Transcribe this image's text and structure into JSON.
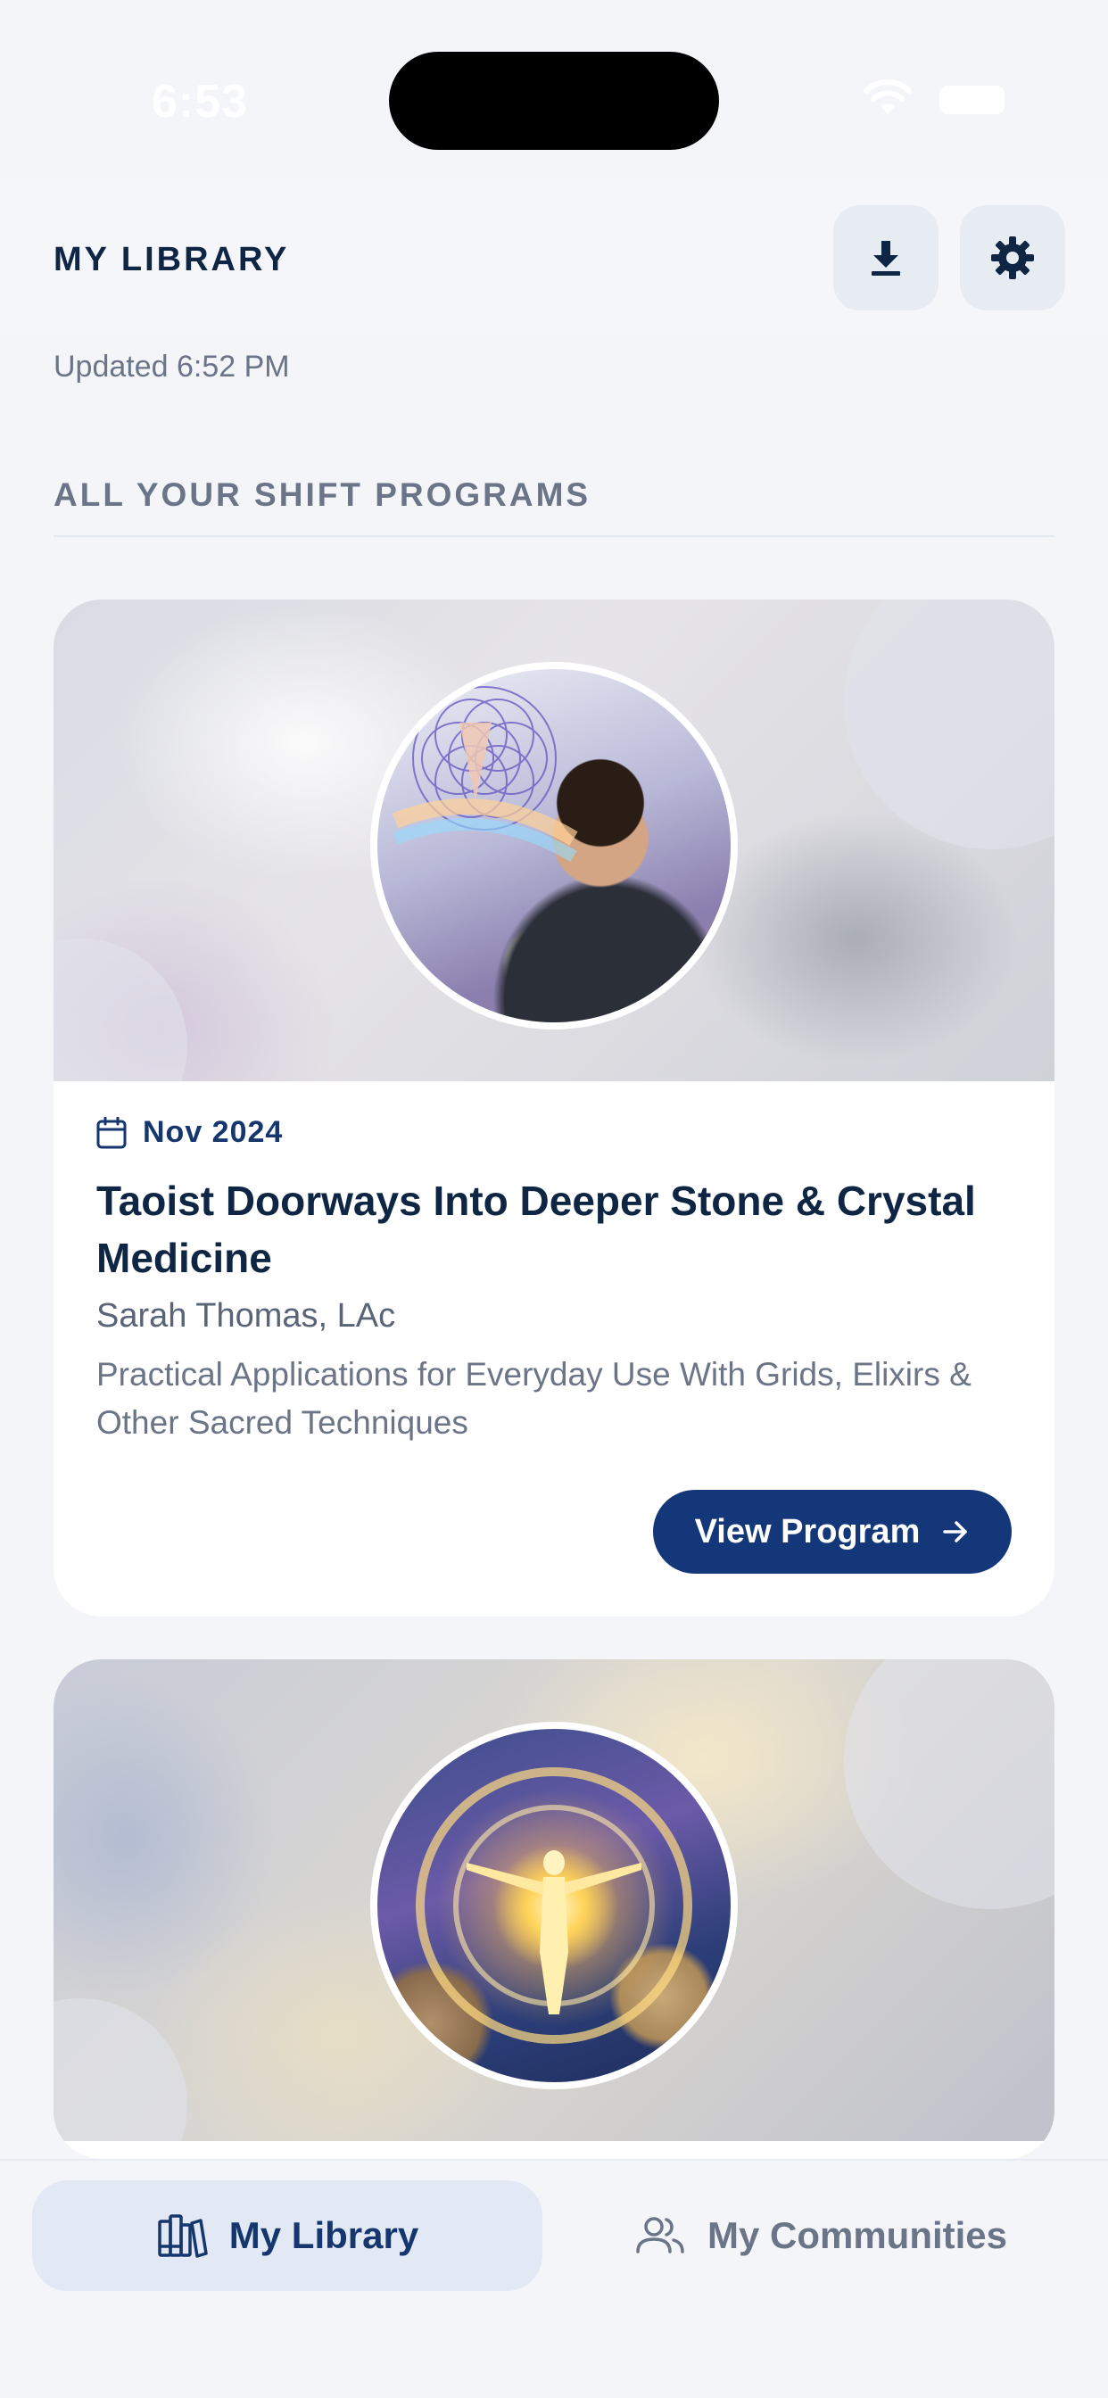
{
  "status_bar": {
    "time": "6:53"
  },
  "header": {
    "title": "MY LIBRARY",
    "download_icon": "download-icon",
    "settings_icon": "gear-icon"
  },
  "updated_text": "Updated 6:52 PM",
  "section_title": "ALL YOUR SHIFT PROGRAMS",
  "programs": [
    {
      "date": "Nov 2024",
      "title": "Taoist Doorways Into Deeper Stone & Crystal Medicine",
      "author": "Sarah Thomas, LAc",
      "description": "Practical Applications for Everyday Use With Grids, Elixirs & Other Sacred Techniques",
      "button_label": "View Program"
    },
    {
      "date": "",
      "title": "",
      "author": "",
      "description": "",
      "button_label": ""
    }
  ],
  "bottom_nav": {
    "items": [
      {
        "label": "My Library",
        "icon": "books-icon",
        "active": true
      },
      {
        "label": "My Communities",
        "icon": "people-icon",
        "active": false
      }
    ]
  },
  "colors": {
    "primary": "#14377a",
    "title_text": "#0f2544",
    "muted_text": "#6b7587",
    "background": "#f3f5f9",
    "active_nav_bg": "#e2e9f4"
  }
}
